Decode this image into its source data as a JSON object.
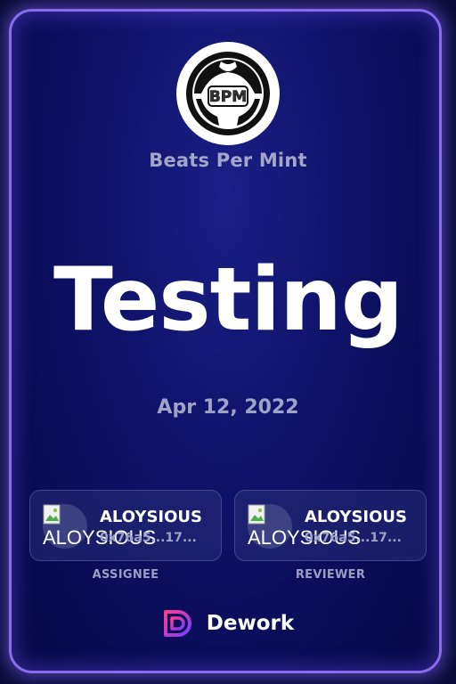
{
  "organization": {
    "name": "Beats Per Mint",
    "logo_text": "BPM"
  },
  "task": {
    "title": "Testing",
    "date": "Apr 12, 2022"
  },
  "assignee": {
    "name": "ALOYSIOUS",
    "address": "0x76a5...17...",
    "avatar_alt": "ALOYSIOUS",
    "role_label": "ASSIGNEE"
  },
  "reviewer": {
    "name": "ALOYSIOUS",
    "address": "0x76a5...17...",
    "avatar_alt": "ALOYSIOUS",
    "role_label": "REVIEWER"
  },
  "footer": {
    "brand": "Dework"
  },
  "colors": {
    "border_glow": "#8a6cf2",
    "background": "#0f1268",
    "text_muted": "#a3a6c9",
    "brand_gradient_start": "#ff3c8e",
    "brand_gradient_end": "#7b3cff"
  },
  "icons": {
    "logo": "bpm-logo-icon",
    "broken_image": "broken-image-icon",
    "footer_logo": "dework-logo-icon"
  }
}
